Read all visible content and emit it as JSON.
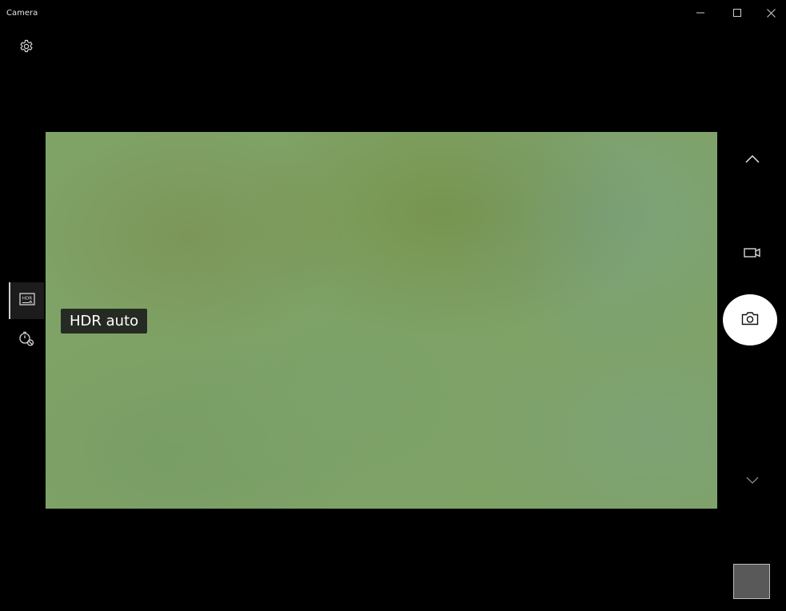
{
  "window": {
    "title": "Camera"
  },
  "titlebar_buttons": {
    "minimize_icon": "minimize-icon",
    "maximize_icon": "maximize-icon",
    "close_icon": "close-icon"
  },
  "left_rail": {
    "settings_icon": "gear-icon",
    "hdr_icon": "hdr-icon",
    "timer_icon": "timer-off-icon"
  },
  "tooltip": {
    "text": "HDR auto"
  },
  "right_rail": {
    "up_icon": "chevron-up-icon",
    "video_icon": "video-camera-icon",
    "photo_icon": "camera-icon",
    "down_icon": "chevron-down-icon"
  },
  "colors": {
    "background": "#000000",
    "viewfinder": "#7fa266",
    "tooltip_bg": "#252b22",
    "shutter_bg": "#ffffff",
    "thumbnail": "#595959"
  }
}
